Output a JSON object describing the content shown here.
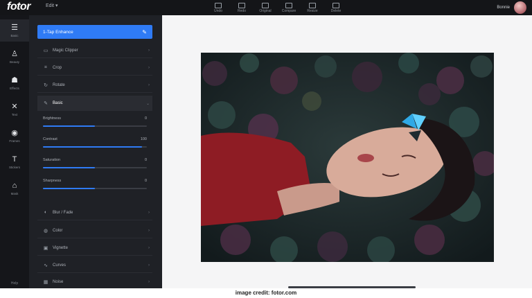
{
  "app": {
    "logo": "fotor",
    "edit_menu": "Edit ▾"
  },
  "toolbar": [
    {
      "label": "Undo",
      "icon": "undo-icon"
    },
    {
      "label": "Redo",
      "icon": "redo-icon"
    },
    {
      "label": "Original",
      "icon": "original-icon"
    },
    {
      "label": "Compare",
      "icon": "compare-icon"
    },
    {
      "label": "Resize",
      "icon": "resize-icon"
    },
    {
      "label": "Delete",
      "icon": "delete-icon"
    }
  ],
  "user": {
    "name": "Bonnie"
  },
  "rail": [
    {
      "label": "Basic",
      "glyph": "☰",
      "icon": "adjust-icon"
    },
    {
      "label": "Beauty",
      "glyph": "♙",
      "icon": "beauty-icon"
    },
    {
      "label": "Effects",
      "glyph": "☗",
      "icon": "effects-icon"
    },
    {
      "label": "Text",
      "glyph": "✕",
      "icon": "text-icon"
    },
    {
      "label": "Frames",
      "glyph": "◉",
      "icon": "frames-icon"
    },
    {
      "label": "Stickers",
      "glyph": "T",
      "icon": "stickers-icon"
    },
    {
      "label": "Mask",
      "glyph": "⌂",
      "icon": "mask-icon"
    }
  ],
  "rail_bottom": "Help",
  "panel": {
    "apply_button": "1-Tap Enhance",
    "rows_top": [
      {
        "label": "Magic Clipper",
        "icon": "clipper-icon",
        "glyph": "▭"
      },
      {
        "label": "Crop",
        "icon": "crop-icon",
        "glyph": "⌗"
      },
      {
        "label": "Rotate",
        "icon": "rotate-icon",
        "glyph": "↻"
      }
    ],
    "active_row": {
      "label": "Basic",
      "icon": "basic-icon",
      "glyph": "✎"
    },
    "sliders": [
      {
        "label": "Brightness",
        "value": "0",
        "fill": 0.5
      },
      {
        "label": "Contrast",
        "value": "100",
        "fill": 0.95
      },
      {
        "label": "Saturation",
        "value": "0",
        "fill": 0.5
      },
      {
        "label": "Sharpness",
        "value": "0",
        "fill": 0.5
      }
    ],
    "rows_bottom": [
      {
        "label": "Blur / Fade",
        "icon": "blur-icon",
        "glyph": "◐"
      },
      {
        "label": "Color",
        "icon": "color-icon",
        "glyph": "◍"
      },
      {
        "label": "Vignette",
        "icon": "vignette-icon",
        "glyph": "▣"
      },
      {
        "label": "Curves",
        "icon": "curves-icon",
        "glyph": "∿"
      },
      {
        "label": "Noise",
        "icon": "noise-icon",
        "glyph": "▦"
      }
    ]
  },
  "credit": "image credit: fotor.com",
  "colors": {
    "accent": "#2f7bf5",
    "panel": "#1f2126",
    "rail": "#15161a",
    "topbar": "#141518"
  }
}
